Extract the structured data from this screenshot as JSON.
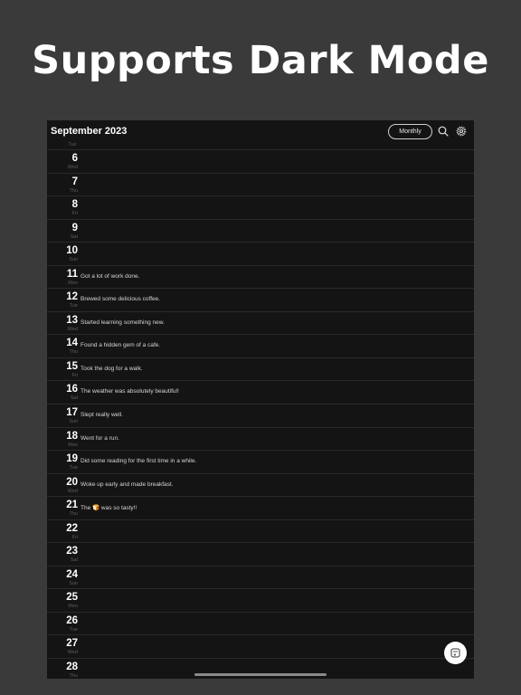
{
  "headline": "Supports Dark Mode",
  "header": {
    "month_title": "September 2023",
    "view_button": "Monthly",
    "search_icon": "search-icon",
    "settings_icon": "gear-icon"
  },
  "first_day_label": "Tue",
  "days": [
    {
      "day": "6",
      "weekday": "Wed",
      "entry": ""
    },
    {
      "day": "7",
      "weekday": "Thu",
      "entry": ""
    },
    {
      "day": "8",
      "weekday": "Fri",
      "entry": ""
    },
    {
      "day": "9",
      "weekday": "Sat",
      "entry": ""
    },
    {
      "day": "10",
      "weekday": "Sun",
      "entry": ""
    },
    {
      "day": "11",
      "weekday": "Mon",
      "entry": "Got a lot of work done."
    },
    {
      "day": "12",
      "weekday": "Tue",
      "entry": "Brewed some delicious coffee."
    },
    {
      "day": "13",
      "weekday": "Wed",
      "entry": "Started learning something new."
    },
    {
      "day": "14",
      "weekday": "Thu",
      "entry": "Found a hidden gem of a cafe."
    },
    {
      "day": "15",
      "weekday": "Fri",
      "entry": "Took the dog for a walk."
    },
    {
      "day": "16",
      "weekday": "Sat",
      "entry": "The weather was absolutely beautiful!"
    },
    {
      "day": "17",
      "weekday": "Sun",
      "entry": "Slept really well."
    },
    {
      "day": "18",
      "weekday": "Mon",
      "entry": "Went for a run."
    },
    {
      "day": "19",
      "weekday": "Tue",
      "entry": "Did some reading for the first time in a while."
    },
    {
      "day": "20",
      "weekday": "Wed",
      "entry": "Woke up early and made breakfast."
    },
    {
      "day": "21",
      "weekday": "Thu",
      "entry": "The 🍞 was so tasty!!"
    },
    {
      "day": "22",
      "weekday": "Fri",
      "entry": ""
    },
    {
      "day": "23",
      "weekday": "Sat",
      "entry": ""
    },
    {
      "day": "24",
      "weekday": "Sun",
      "entry": ""
    },
    {
      "day": "25",
      "weekday": "Mon",
      "entry": ""
    },
    {
      "day": "26",
      "weekday": "Tue",
      "entry": ""
    },
    {
      "day": "27",
      "weekday": "Wed",
      "entry": ""
    },
    {
      "day": "28",
      "weekday": "Thu",
      "entry": ""
    }
  ],
  "fab_icon": "calendar-return-icon",
  "colors": {
    "outer_background": "#3a3a3a",
    "app_background": "#141414",
    "text_primary": "#ffffff",
    "text_muted": "#5e5e5e"
  }
}
